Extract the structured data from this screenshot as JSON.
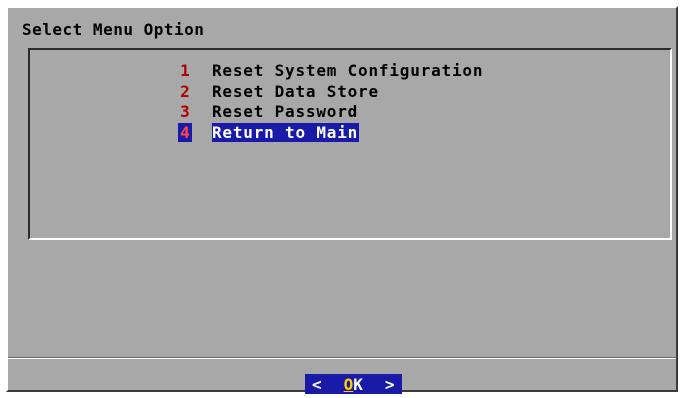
{
  "dialog": {
    "title": "Select Menu Option"
  },
  "menu": {
    "selected_index": 3,
    "items": [
      {
        "number": "1",
        "label": "Reset System Configuration"
      },
      {
        "number": "2",
        "label": "Reset Data Store"
      },
      {
        "number": "3",
        "label": "Reset Password"
      },
      {
        "number": "4",
        "label": "Return to Main"
      }
    ]
  },
  "buttons": {
    "ok": {
      "left_bracket": "<",
      "hotkey": "O",
      "rest": "K",
      "right_bracket": ">"
    }
  },
  "colors": {
    "background": "#a8a8a8",
    "selection": "#1a1aa8",
    "number_text": "#b00000",
    "selected_text": "#ffffff"
  }
}
